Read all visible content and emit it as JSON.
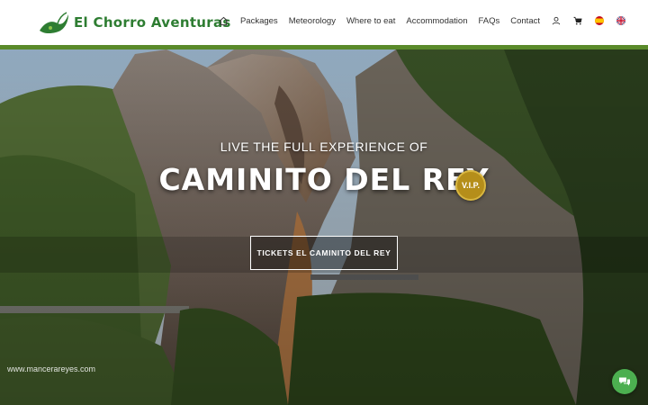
{
  "brand": {
    "name": "El Chorro Aventuras",
    "accent_color": "#5a8a2a",
    "logo_color": "#2e7d32"
  },
  "nav": {
    "items": [
      {
        "label": "Packages"
      },
      {
        "label": "Meteorology"
      },
      {
        "label": "Where to eat"
      },
      {
        "label": "Accommodation"
      },
      {
        "label": "FAQs"
      },
      {
        "label": "Contact"
      }
    ],
    "icons": [
      "home-icon",
      "user-icon",
      "cart-icon",
      "flag-es-icon",
      "flag-uk-icon"
    ]
  },
  "hero": {
    "subtitle": "LIVE THE FULL EXPERIENCE OF",
    "title": "CAMINITO DEL REY",
    "badge": "V.I.P.",
    "cta_label": "TICKETS EL CAMINITO DEL REY",
    "watermark": "www.mancerareyes.com"
  },
  "chat": {
    "icon": "chat-icon",
    "color": "#4caf50"
  }
}
